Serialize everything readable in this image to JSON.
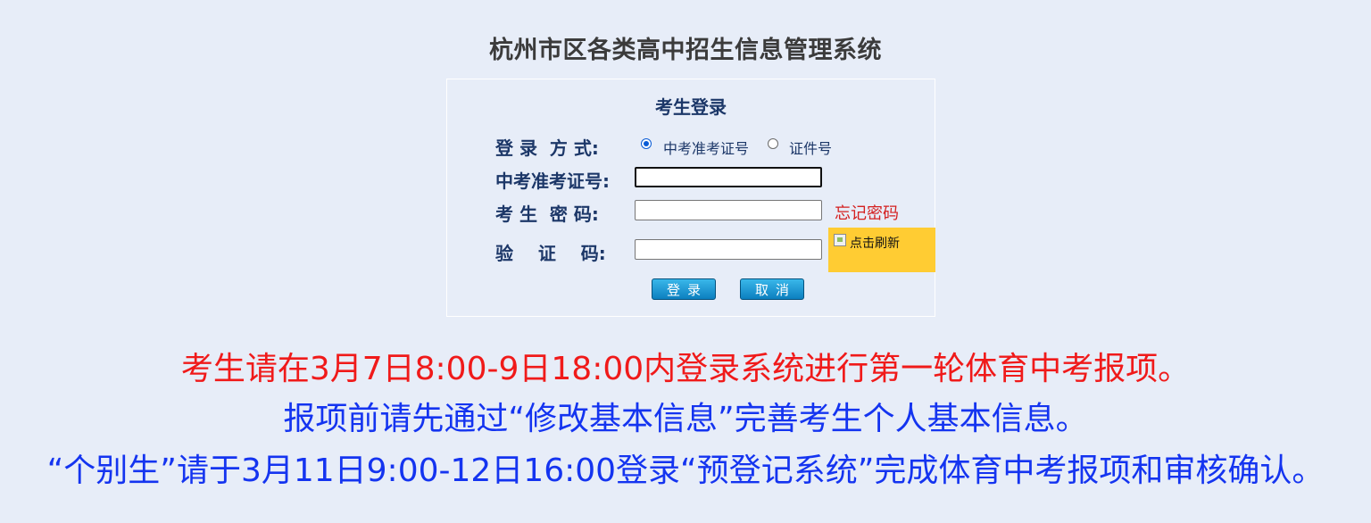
{
  "header": {
    "title": "杭州市区各类高中招生信息管理系统"
  },
  "login": {
    "panel_title": "考生登录",
    "method_label": "登 录  方 式:",
    "method_options": [
      "中考准考证号",
      "证件号"
    ],
    "method_selected": "中考准考证号",
    "exam_id_label": "中考准考证号:",
    "exam_id_value": "",
    "password_label": "考 生  密 码:",
    "password_value": "",
    "forgot_link": "忘记密码",
    "captcha_label": "验    证    码:",
    "captcha_value": "",
    "captcha_alt": "点击刷新",
    "login_button": "登录",
    "cancel_button": "取消"
  },
  "notices": [
    "考生请在3月7日8:00-9日18:00内登录系统进行第一轮体育中考报项。",
    "报项前请先通过“修改基本信息”完善考生个人基本信息。",
    "“个别生”请于3月11日9:00-12日16:00登录“预登记系统”完成体育中考报项和审核确认。"
  ],
  "colors": {
    "background": "#e7edf8",
    "label_text": "#1c3768",
    "alert_red": "#f01a1a",
    "notice_blue": "#1434f0",
    "captcha_bg": "#ffcc33",
    "button_blue": "#0c7fbf"
  }
}
